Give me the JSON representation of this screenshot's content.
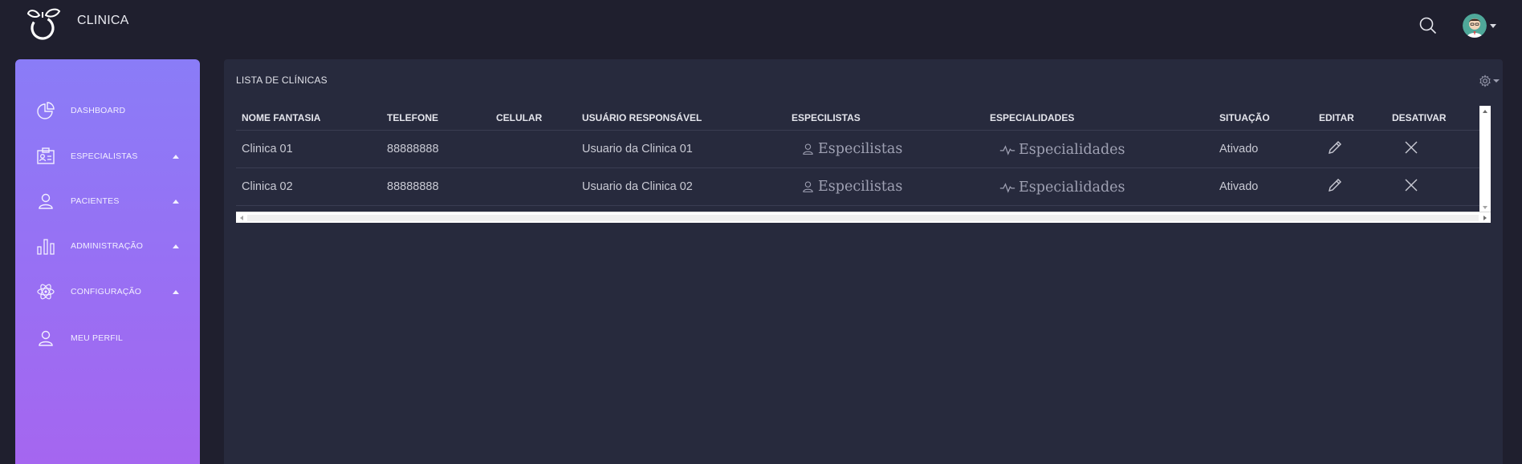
{
  "app": {
    "brand": "CLINICA"
  },
  "colors": {
    "sidebar_top": "#8a7cf7",
    "sidebar_bottom": "#a566f0",
    "background": "#1f1f2e",
    "panel": "#272a3d"
  },
  "sidebar": {
    "items": [
      {
        "label": "DASHBOARD",
        "icon": "pie-chart-icon",
        "has_caret": false
      },
      {
        "label": "ESPECIALISTAS",
        "icon": "id-card-icon",
        "has_caret": true
      },
      {
        "label": "PACIENTES",
        "icon": "user-icon",
        "has_caret": true
      },
      {
        "label": "ADMINISTRAÇÃO",
        "icon": "bar-chart-icon",
        "has_caret": true
      },
      {
        "label": "CONFIGURAÇÃO",
        "icon": "atom-icon",
        "has_caret": true
      },
      {
        "label": "MEU PERFIL",
        "icon": "user-icon",
        "has_caret": false
      }
    ]
  },
  "panel": {
    "title": "LISTA DE CLÍNICAS",
    "table": {
      "columns": [
        "NOME FANTASIA",
        "TELEFONE",
        "CELULAR",
        "USUÁRIO RESPONSÁVEL",
        "ESPECILISTAS",
        "ESPECIALIDADES",
        "SITUAÇÃO",
        "EDITAR",
        "DESATIVAR"
      ],
      "rows": [
        {
          "nome": "Clinica 01",
          "telefone": "88888888",
          "celular": "",
          "usuario": "Usuario da Clinica 01",
          "especialistas": "Especilistas",
          "especialidades": "Especialidades",
          "situacao": "Ativado"
        },
        {
          "nome": "Clinica 02",
          "telefone": "88888888",
          "celular": "",
          "usuario": "Usuario da Clinica 02",
          "especialistas": "Especilistas",
          "especialidades": "Especialidades",
          "situacao": "Ativado"
        }
      ]
    }
  }
}
